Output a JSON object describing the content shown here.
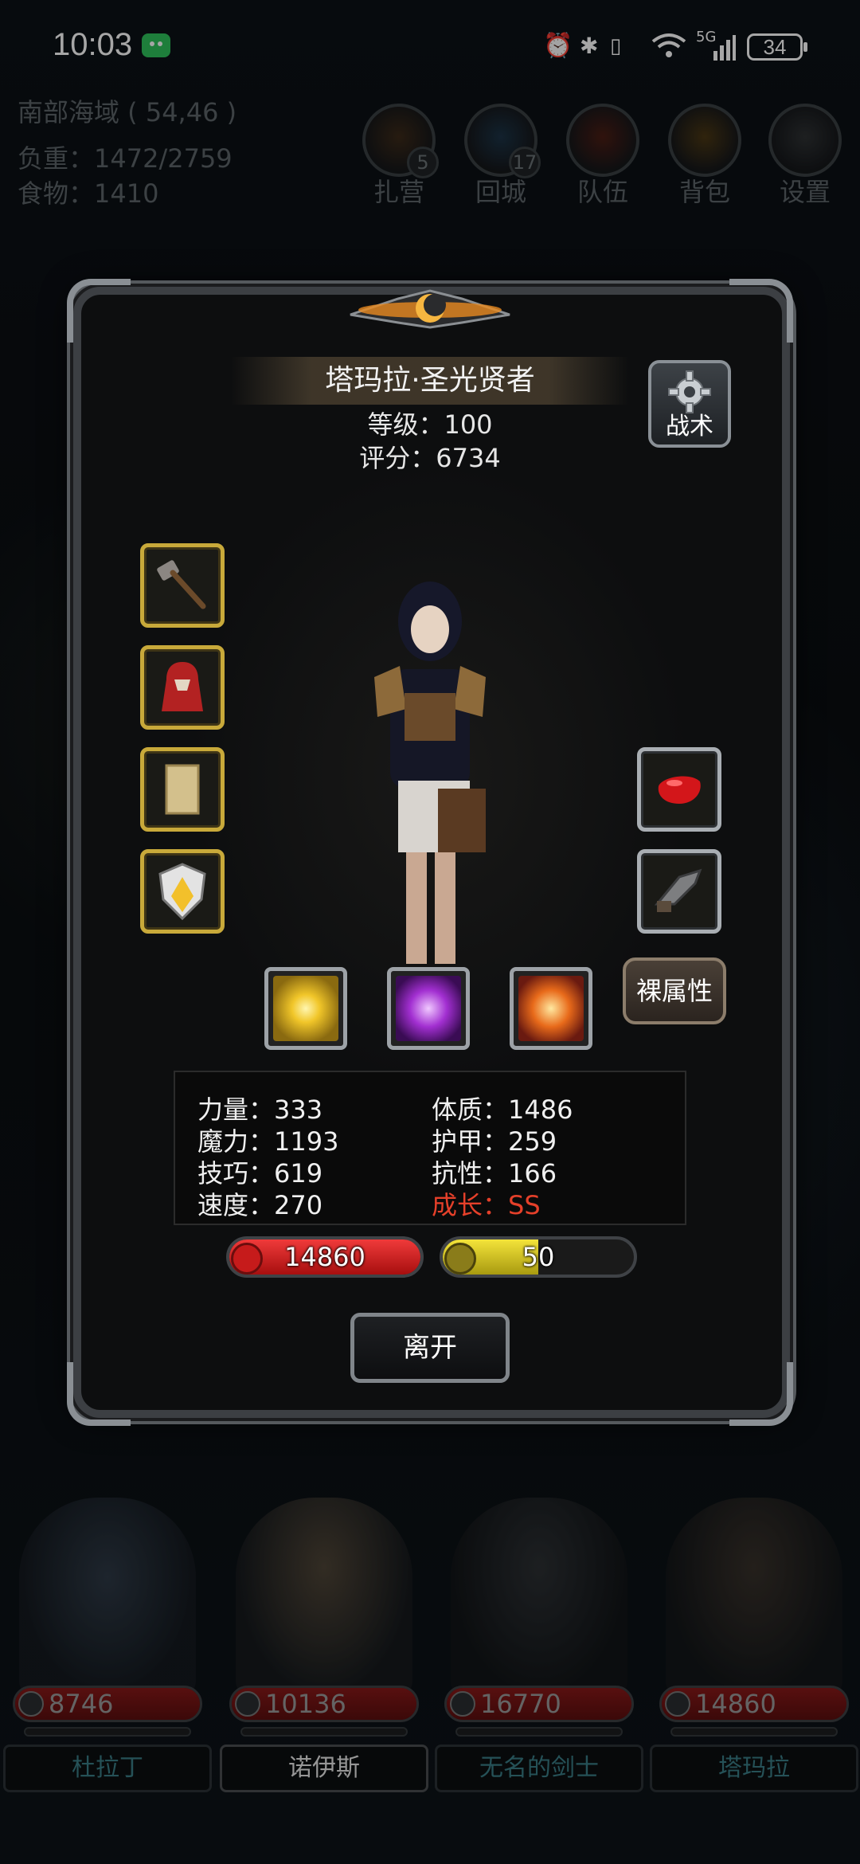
{
  "status_bar": {
    "time": "10:03",
    "network": "5G",
    "battery": "34"
  },
  "hud": {
    "location": "南部海域 ( 54,46 )",
    "weight": "负重：1472/2759",
    "food": "食物：1410",
    "buttons": [
      {
        "label": "扎营",
        "badge": "5",
        "icon": "campfire-icon"
      },
      {
        "label": "回城",
        "badge": "17",
        "icon": "portal-icon"
      },
      {
        "label": "队伍",
        "badge": "",
        "icon": "team-icon"
      },
      {
        "label": "背包",
        "badge": "",
        "icon": "backpack-icon"
      },
      {
        "label": "设置",
        "badge": "",
        "icon": "gear-icon"
      }
    ]
  },
  "hero": {
    "name": "塔玛拉·圣光贤者",
    "level": "等级：100",
    "score": "评分：6734",
    "tactics_label": "战术",
    "naked_attr_label": "裸属性",
    "left_equipment": [
      "hammer-icon",
      "red-cloak-icon",
      "scroll-icon",
      "shield-icon"
    ],
    "right_equipment": [
      "red-gem-icon",
      "gauntlet-icon"
    ],
    "skills": [
      "holy-burst-icon",
      "arcane-note-icon",
      "flame-cross-icon"
    ],
    "stats": {
      "strength": "力量：333",
      "magic": "魔力：1193",
      "skill": "技巧：619",
      "speed": "速度：270",
      "constitution": "体质：1486",
      "armor": "护甲：259",
      "resistance": "抗性：166",
      "growth": "成长：SS"
    },
    "hp": "14860",
    "energy": "50",
    "energy_ratio": 0.5,
    "leave_label": "离开"
  },
  "team": [
    {
      "name": "杜拉丁",
      "hp": "8746",
      "active": false
    },
    {
      "name": "诺伊斯",
      "hp": "10136",
      "active": true
    },
    {
      "name": "无名的剑士",
      "hp": "16770",
      "active": false
    },
    {
      "name": "塔玛拉",
      "hp": "14860",
      "active": false
    }
  ],
  "colors": {
    "gold_frame": "#c8a93a",
    "silver_frame": "#a9aeb3",
    "hp_red": "#d21d1d",
    "energy_yellow": "#e2d21a",
    "growth_red": "#e5402a"
  }
}
